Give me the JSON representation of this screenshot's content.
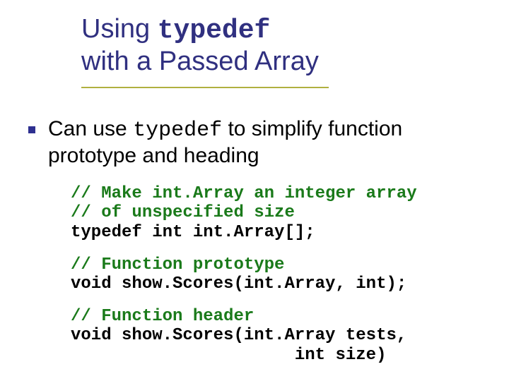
{
  "title": {
    "line1_prefix": "Using ",
    "line1_code": "typedef",
    "line2": "with a Passed Array"
  },
  "bullet": {
    "pre": "Can use ",
    "code": "typedef",
    "post": " to simplify function prototype and heading"
  },
  "code1": {
    "c1": "// Make int.Array an integer array",
    "c2": "// of unspecified size",
    "l1": "typedef int int.Array[];"
  },
  "code2": {
    "c1": "// Function prototype",
    "l1": "void show.Scores(int.Array, int);"
  },
  "code3": {
    "c1": "// Function header",
    "l1": "void show.Scores(int.Array tests,",
    "l2": "                      int size)"
  }
}
